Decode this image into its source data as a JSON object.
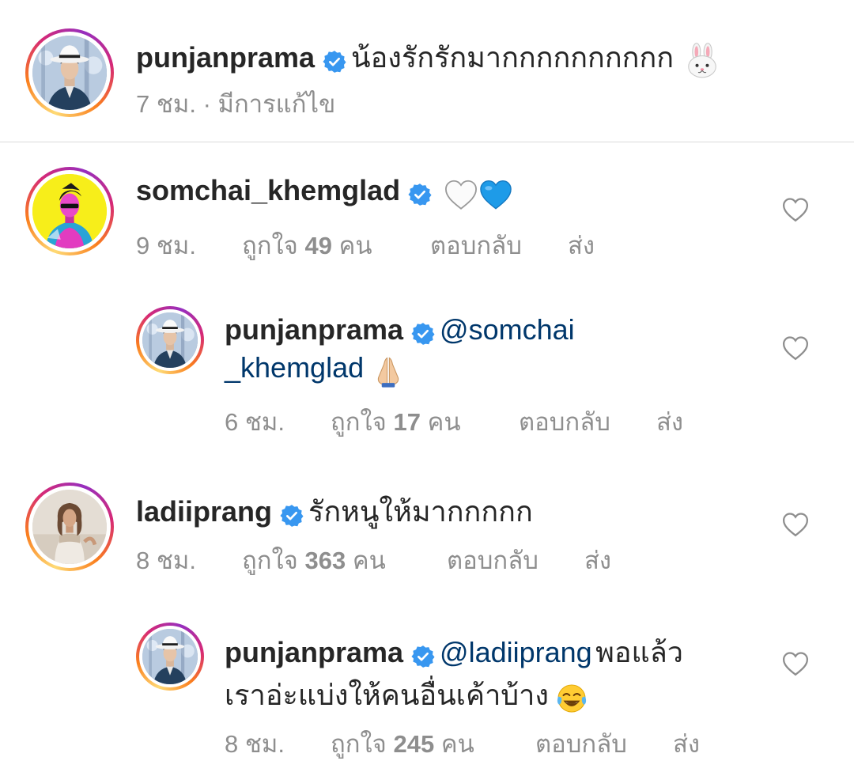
{
  "caption": {
    "username": "punjanprama",
    "text": "น้องรักรักมากกกกกกกกกก",
    "emoji": "rabbit-face",
    "time": "7 ชม.",
    "separator": "·",
    "edited": "มีการแก้ไข"
  },
  "comments": [
    {
      "username": "somchai_khemglad",
      "text": "",
      "emoji": "white-heart blue-heart",
      "time": "9 ชม.",
      "likes_label": "ถูกใจ",
      "likes_count": "49",
      "likes_unit": "คน",
      "reply": "ตอบกลับ",
      "send": "ส่ง",
      "replies": [
        {
          "username": "punjanprama",
          "mention_line1": "@somchai",
          "mention_line2": "_khemglad",
          "emoji": "folded-hands",
          "time": "6 ชม.",
          "likes_label": "ถูกใจ",
          "likes_count": "17",
          "likes_unit": "คน",
          "reply": "ตอบกลับ",
          "send": "ส่ง"
        }
      ]
    },
    {
      "username": "ladiiprang",
      "text": "รักหนูให้มากกกกก",
      "time": "8 ชม.",
      "likes_label": "ถูกใจ",
      "likes_count": "363",
      "likes_unit": "คน",
      "reply": "ตอบกลับ",
      "send": "ส่ง",
      "replies": [
        {
          "username": "punjanprama",
          "mention": "@ladiiprang",
          "text_line1": "พอแล้ว",
          "text_line2": "เราอ่ะแบ่งให้คนอื่นเค้าบ้าง",
          "emoji": "face-with-tears-of-joy",
          "time": "8 ชม.",
          "likes_label": "ถูกใจ",
          "likes_count": "245",
          "likes_unit": "คน",
          "reply": "ตอบกลับ",
          "send": "ส่ง"
        }
      ]
    }
  ],
  "colors": {
    "text": "#262626",
    "meta": "#8e8e8e",
    "mention": "#00376b",
    "verified": "#3897f0",
    "divider": "#dbdbdb"
  }
}
